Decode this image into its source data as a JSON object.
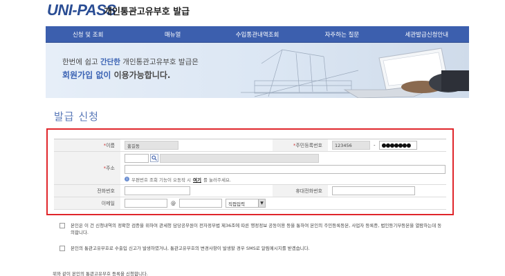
{
  "header": {
    "logo": "UNI-PASS",
    "title": "개인통관고유부호 발급"
  },
  "nav": [
    {
      "label": "신청 및 조회"
    },
    {
      "label": "매뉴얼"
    },
    {
      "label": "수입통관내역조회"
    },
    {
      "label": "자주하는 질문"
    },
    {
      "label": "세관발급신청안내"
    }
  ],
  "banner": {
    "line1_a": "한번에 쉽고 ",
    "line1_hl": "간단한",
    "line1_b": " 개인통관고유부호 발급은",
    "line2_hl": "회원가입 없이",
    "line2_b": " 이용가능합니다."
  },
  "page_title": "발급 신청",
  "form": {
    "name_label": "이름",
    "name_value": "홍길동",
    "rrn_label": "주민등록번호",
    "rrn_front": "123456",
    "rrn_dash": "-",
    "rrn_back": "●●●●●●●",
    "address_label": "주소",
    "address_hint_a": "우편번호 조회 기능이 오동작 시 ",
    "address_hint_link": "여기",
    "address_hint_b": "를 눌러주세요.",
    "phone_label": "전화번호",
    "mobile_label": "휴대전화번호",
    "email_label": "이메일",
    "email_at": "@",
    "email_domain_select": "직접입력",
    "required_mark": "*"
  },
  "agreements": [
    {
      "text": "본인은 이 건 신청내역의 정확한 검증을 위하여 관세청 담당공무원이 전자정부법 제36조에 따른 행정정보 공동이용 등을 통하여 본인의 주민등록등본, 사업자 등록증, 법인등기부등본을 열람하는데 동의합니다."
    },
    {
      "text": "본인의 통관고유부호로 수출입 신고가 발생하였거나, 통관고유부호의 변경사항이 발생할 경우 SMS로 알림메시지를 받겠습니다."
    }
  ],
  "footnote": "위와 같이 본인의 통관고유부호 등록을 신청합니다.",
  "colors": {
    "nav_bg": "#3c5fae",
    "highlight_box": "#e0252a",
    "title": "#5a79b8"
  }
}
